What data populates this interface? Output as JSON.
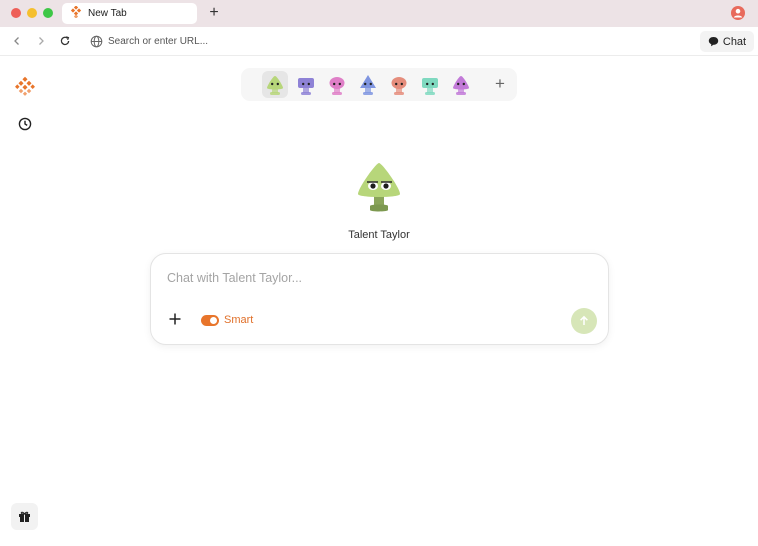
{
  "tab": {
    "title": "New Tab"
  },
  "address_bar": {
    "placeholder": "Search or enter URL..."
  },
  "chat_button": {
    "label": "Chat"
  },
  "avatars": [
    {
      "name": "green-avatar",
      "color": "#b7d67a",
      "selected": true
    },
    {
      "name": "purple-avatar",
      "color": "#8e82d6"
    },
    {
      "name": "pink-avatar",
      "color": "#df7fc7"
    },
    {
      "name": "blue-avatar",
      "color": "#7f95e0"
    },
    {
      "name": "salmon-avatar",
      "color": "#e58d7c"
    },
    {
      "name": "teal-avatar",
      "color": "#7fd9c0"
    },
    {
      "name": "violet-avatar",
      "color": "#c27ad8"
    }
  ],
  "assistant": {
    "name": "Talent Taylor"
  },
  "chat": {
    "placeholder": "Chat with Talent Taylor...",
    "smart_label": "Smart",
    "smart_enabled": true
  },
  "colors": {
    "accent": "#e8752b",
    "send_disabled": "#d7e6b8",
    "hero_green": "#b7d67a"
  }
}
